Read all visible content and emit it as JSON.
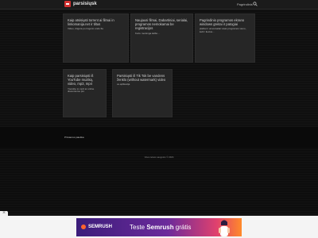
{
  "header": {
    "logo_text": "parsisiųsk",
    "link": "Pagrindinis"
  },
  "cards": [
    {
      "title": "Kaip atsisiųsti torrent ai filmai in linkomanija.net ir tiltus",
      "desc": "Video, itrigėra po tingerio ondo fia"
    },
    {
      "title": "Naujausi filmai, Dabartiniai, serialai, programos nemokamai be registracijos",
      "desc": "Kuriu mersinga kalbo..."
    },
    {
      "title": "Pagrindinio programos ekrano windows greitai ir patogiai",
      "desc": "plačiai ir universaliai visas programos vieno, kelti / liecius..."
    },
    {
      "title": "Kaip parsisiųsti iš YouTube muziką, video, mp3, mp4",
      "desc": "Youtube to mp3 ar online discomiumo pro"
    },
    {
      "title": "Parsisiųsti iš Tik Tok be vandens ženklo (without watermark) video",
      "desc": "ve.aplikacija"
    }
  ],
  "footer": {
    "popular": "Priviaurus paieška",
    "copyright": "Visos teisės saugotos © 2024"
  },
  "ad": {
    "brand": "SEMRUSH",
    "text_prefix": "Teste ",
    "text_brand": "Semrush",
    "text_suffix": " grátis"
  },
  "colors": {
    "background": "#121212",
    "card": "#262626",
    "logo_red": "#d23131",
    "ad_orange": "#ff642d"
  }
}
